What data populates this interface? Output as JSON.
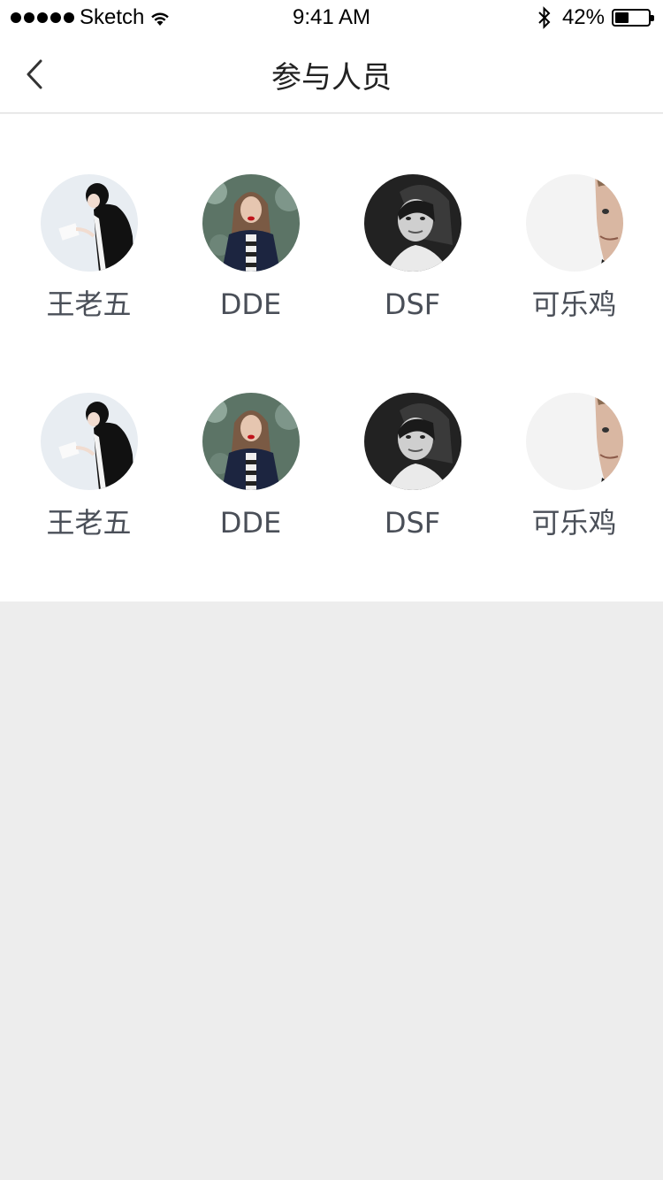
{
  "status_bar": {
    "carrier": "Sketch",
    "time": "9:41 AM",
    "battery_percent": "42%",
    "battery_level": 0.42,
    "icons": [
      "signal-dots-icon",
      "wifi-icon",
      "bluetooth-icon",
      "battery-icon"
    ]
  },
  "nav": {
    "title": "参与人员",
    "back_icon": "chevron-left-icon"
  },
  "members": [
    {
      "name": "王老五",
      "avatar": "avatar-illustrated-boy"
    },
    {
      "name": "DDE",
      "avatar": "avatar-woman-red-lips"
    },
    {
      "name": "DSF",
      "avatar": "avatar-woman-bw"
    },
    {
      "name": "可乐鸡",
      "avatar": "avatar-man-half-face"
    },
    {
      "name": "王老五",
      "avatar": "avatar-illustrated-boy"
    },
    {
      "name": "DDE",
      "avatar": "avatar-woman-red-lips"
    },
    {
      "name": "DSF",
      "avatar": "avatar-woman-bw"
    },
    {
      "name": "可乐鸡",
      "avatar": "avatar-man-half-face"
    }
  ],
  "colors": {
    "background": "#ededed",
    "surface": "#ffffff",
    "name_text": "#4a4f58",
    "title_text": "#222222",
    "divider": "#e3e3e3"
  }
}
